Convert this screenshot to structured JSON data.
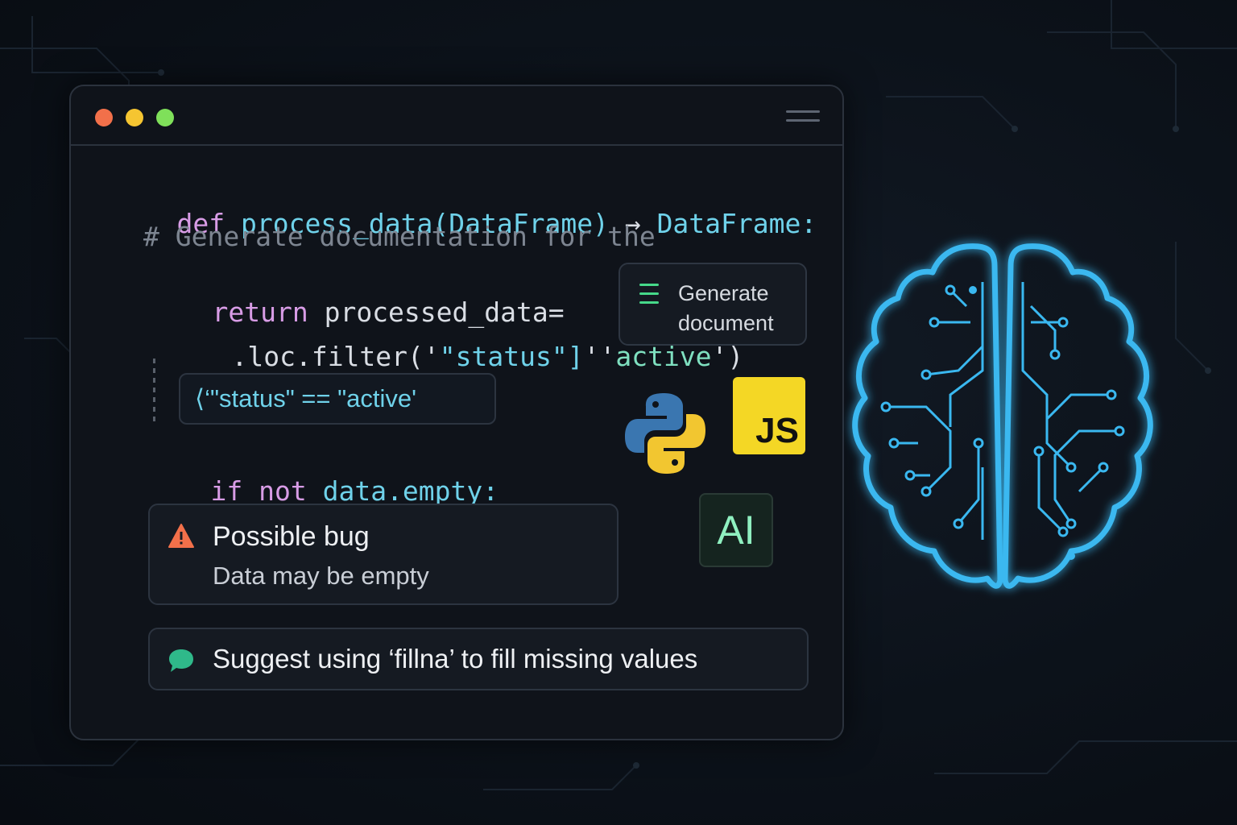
{
  "editor": {
    "code_lines": {
      "line1": {
        "def": "def",
        "signature": "process_data(DataFrame)",
        "arrow": "→",
        "return_type": "DataFrame:"
      },
      "line2": {
        "comment": "# Generate documentation for the"
      },
      "line3": {
        "return_kw": "return",
        "rest": "processed_data="
      },
      "line4": {
        "method": ".loc.filter(",
        "quote": "'",
        "str1": "\"status\"]",
        "quote2": "''",
        "str2": "active",
        "close": "')"
      },
      "line5": {
        "if_kw": "if",
        "not_kw": "not",
        "expr": "data.empty:"
      }
    },
    "inline_suggestion": "⟨‘\"status\" == \"active'",
    "generate_doc_label": "Generate document",
    "bug_card": {
      "title": "Possible bug",
      "description": "Data may be empty"
    },
    "suggestion_card": {
      "text": "Suggest using ‘fillna’ to fill missing values"
    }
  },
  "badges": {
    "js": "JS",
    "ai": "AI"
  },
  "icons": [
    "menu-icon",
    "document-icon",
    "warning-icon",
    "chat-bubble-icon",
    "python-logo",
    "brain-icon"
  ],
  "colors": {
    "accent_blue": "#3ab8f0",
    "keyword": "#d89ce6",
    "function": "#6fd2ea",
    "string": "#7fe0c0",
    "warning": "#f2704a",
    "success": "#46d98a"
  }
}
